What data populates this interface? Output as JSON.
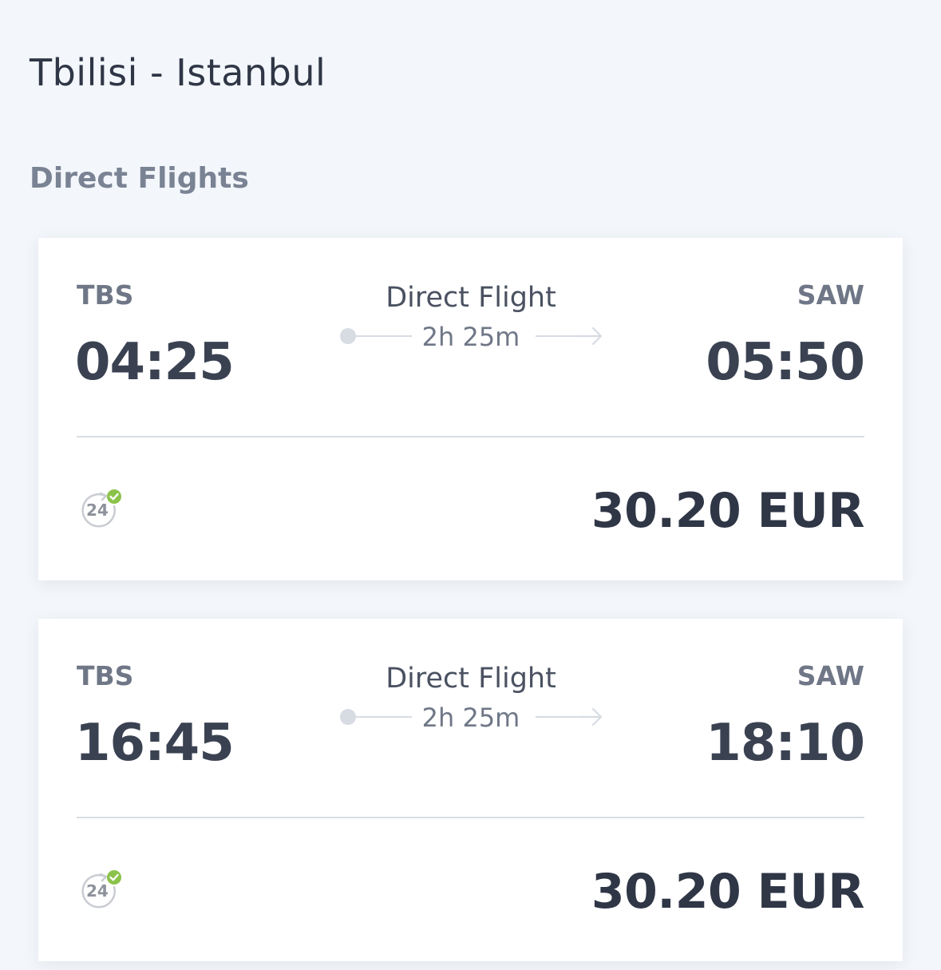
{
  "header": {
    "route_title": "Tbilisi - Istanbul",
    "section_title": "Direct Flights"
  },
  "flights": [
    {
      "from_code": "TBS",
      "to_code": "SAW",
      "departure_time": "04:25",
      "arrival_time": "05:50",
      "flight_type": "Direct Flight",
      "duration": "2h 25m",
      "badge_text": "24",
      "price": "30.20 EUR"
    },
    {
      "from_code": "TBS",
      "to_code": "SAW",
      "departure_time": "16:45",
      "arrival_time": "18:10",
      "flight_type": "Direct Flight",
      "duration": "2h 25m",
      "badge_text": "24",
      "price": "30.20 EUR"
    }
  ],
  "colors": {
    "background": "#f3f6fa",
    "card": "#ffffff",
    "text_dark": "#2f3646",
    "text_muted": "#6f7787",
    "check_green": "#8bc34a",
    "line_gray": "#d7dce3"
  },
  "icons": {
    "badge": "24h-free-cancellation-icon",
    "arrow": "arrow-right-icon",
    "check": "check-icon"
  }
}
